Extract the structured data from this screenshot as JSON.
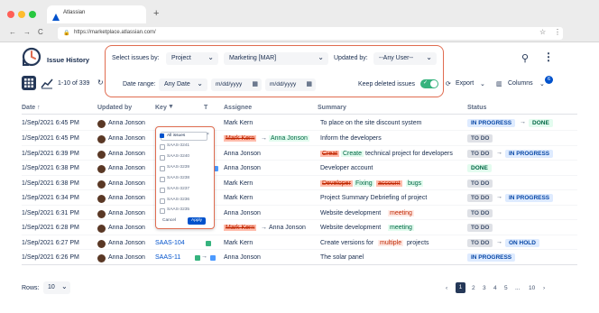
{
  "browser": {
    "tab_title": "Atlassian",
    "new_tab": "+",
    "url": "https://marketplace.atlassian.com/",
    "back": "←",
    "forward": "→",
    "reload": "C",
    "star": "☆",
    "menu": "⋮"
  },
  "header": {
    "title": "Issue History",
    "select_label": "Select issues by:",
    "select_type": "Project",
    "select_project": "Marketing [MAR]",
    "updated_by_label": "Updated by:",
    "updated_by_value": "--Any User--",
    "date_range_label": "Date range:",
    "date_range_value": "Any Date",
    "date_from_placeholder": "m/dd/yyyy",
    "date_to_placeholder": "m/dd/yyyy",
    "deleted_label": "Keep deleted issues",
    "pager": "1-10 of 339",
    "export_label": "Export",
    "columns_label": "Columns",
    "columns_badge": "6"
  },
  "table": {
    "headers": [
      "Date ↑",
      "Updated by",
      "Key",
      "T",
      "Assignee",
      "Summary",
      "Status"
    ],
    "rows": [
      {
        "date": "1/Sep/2021 6:45 PM",
        "user": "Anna Jonson",
        "key": "",
        "assignee": "Mark Kern",
        "summary": "To place on the site discount system"
      },
      {
        "date": "1/Sep/2021 6:45 PM",
        "user": "Anna Jonson",
        "key": "",
        "assignee_old": "Mark Kern",
        "assignee_new": "Anna Jonson",
        "summary": "Inform the developers"
      },
      {
        "date": "1/Sep/2021 6:39 PM",
        "user": "Anna Jonson",
        "key": "",
        "assignee": "Anna Jonson",
        "summary_a": "Creat",
        "summary_b": "Create",
        "summary_c": "technical project for developers"
      },
      {
        "date": "1/Sep/2021 6:38 PM",
        "user": "Anna Jonson",
        "key": "",
        "assignee": "Anna Jonson",
        "summary": "Developer account"
      },
      {
        "date": "1/Sep/2021 6:38 PM",
        "user": "Anna Jonson",
        "key": "",
        "assignee": "Mark Kern",
        "summary_a": "Developer",
        "summary_b": "Fixing",
        "summary_c": "account",
        "summary_d": "bugs"
      },
      {
        "date": "1/Sep/2021 6:34 PM",
        "user": "Anna Jonson",
        "key": "",
        "assignee": "Mark Kern",
        "summary": "Project Summary Debriefing of project"
      },
      {
        "date": "1/Sep/2021 6:31 PM",
        "user": "Anna Jonson",
        "key": "",
        "assignee": "Anna Jonson",
        "summary_a": "Website development",
        "summary_b": "meeting"
      },
      {
        "date": "1/Sep/2021 6:28 PM",
        "user": "Anna Jonson",
        "key": "",
        "assignee_old": "Mark Kern",
        "assignee_new": "Anna Jonson",
        "summary_a": "Website development",
        "summary_b": "meeting"
      },
      {
        "date": "1/Sep/2021 6:27 PM",
        "user": "Anna Jonson",
        "key": "SAAS-104",
        "assignee": "Mark Kern",
        "summary_a": "Create versions for",
        "summary_b": "multiple",
        "summary_c": "projects"
      },
      {
        "date": "1/Sep/2021 6:26 PM",
        "user": "Anna Jonson",
        "key": "SAAS-11",
        "assignee": "Anna Jonson",
        "summary": "The solar panel"
      }
    ],
    "status": {
      "in_progress": "IN PROGRESS",
      "done": "DONE",
      "to_do": "TO DO",
      "on_hold": "ON HOLD"
    }
  },
  "key_dropdown": {
    "items": [
      "All issues",
      "SAAS-3241",
      "SAAS-3240",
      "SAAS-3239",
      "SAAS-3238",
      "SAAS-3237",
      "SAAS-3236",
      "SAAS-3235"
    ],
    "cancel": "Cancel",
    "apply": "Apply"
  },
  "footer": {
    "rows_label": "Rows:",
    "rows_value": "10",
    "pages": [
      "1",
      "2",
      "3",
      "4",
      "5",
      "...",
      "10"
    ]
  },
  "colors": {
    "accent": "#0052cc",
    "highlight_border": "#e06c50",
    "dark": "#253858"
  }
}
